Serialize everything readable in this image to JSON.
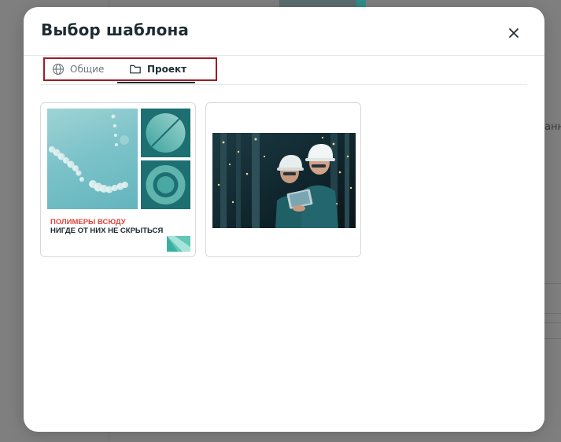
{
  "modal": {
    "title": "Выбор шаблона",
    "close_icon": "close-icon"
  },
  "tabs": [
    {
      "label": "Общие",
      "icon": "globe-icon",
      "active": false
    },
    {
      "label": "Проект",
      "icon": "folder-icon",
      "active": true
    }
  ],
  "templates": [
    {
      "kind": "poster",
      "line1": "ПОЛИМЕРЫ ВСЮДУ",
      "line2": "НИГДЕ ОТ НИХ НЕ СКРЫТЬСЯ",
      "accent_color": "#e0453e",
      "tile_color": "#1d6f72"
    },
    {
      "kind": "photo",
      "image": "engineers-with-tablet"
    }
  ],
  "background": {
    "fragment_text": "анн"
  },
  "colors": {
    "highlight_border": "#9e1b24",
    "title": "#1f2c33",
    "divider": "#e6e9eb"
  }
}
